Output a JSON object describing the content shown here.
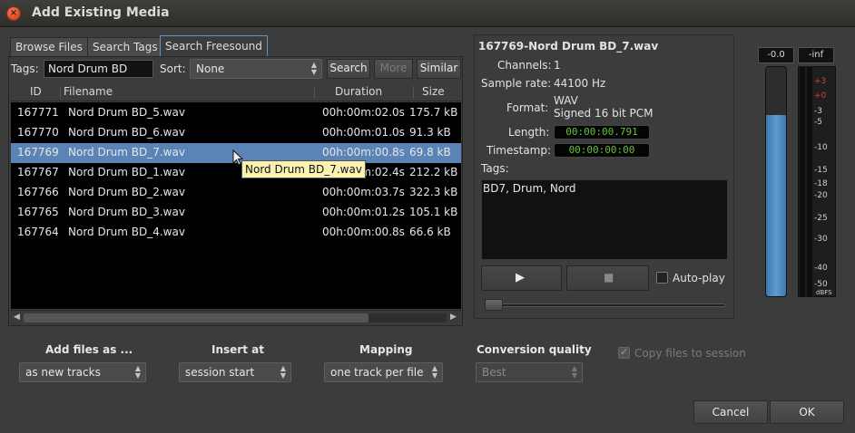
{
  "window": {
    "title": "Add Existing Media",
    "close_glyph": "×"
  },
  "tabs": [
    {
      "label": "Browse Files"
    },
    {
      "label": "Search Tags"
    },
    {
      "label": "Search Freesound"
    }
  ],
  "search": {
    "tags_label": "Tags:",
    "tags_value": "Nord Drum BD",
    "sort_label": "Sort:",
    "sort_value": "None",
    "search_button": "Search",
    "more_button": "More",
    "similar_button": "Similar"
  },
  "table": {
    "columns": [
      "ID",
      "Filename",
      "Duration",
      "Size"
    ],
    "rows": [
      {
        "id": "167771",
        "filename": "Nord Drum BD_5.wav",
        "duration": "00h:00m:02.0s",
        "size": "175.7 kB"
      },
      {
        "id": "167770",
        "filename": "Nord Drum BD_6.wav",
        "duration": "00h:00m:01.0s",
        "size": "91.3 kB"
      },
      {
        "id": "167769",
        "filename": "Nord Drum BD_7.wav",
        "duration": "00h:00m:00.8s",
        "size": "69.8 kB"
      },
      {
        "id": "167767",
        "filename": "Nord Drum BD_1.wav",
        "duration": "00h:00m:02.4s",
        "size": "212.2 kB"
      },
      {
        "id": "167766",
        "filename": "Nord Drum BD_2.wav",
        "duration": "00h:00m:03.7s",
        "size": "322.3 kB"
      },
      {
        "id": "167765",
        "filename": "Nord Drum BD_3.wav",
        "duration": "00h:00m:01.2s",
        "size": "105.1 kB"
      },
      {
        "id": "167764",
        "filename": "Nord Drum BD_4.wav",
        "duration": "00h:00m:00.8s",
        "size": "66.6 kB"
      }
    ],
    "selected_index": 2,
    "tooltip": "Nord Drum BD_7.wav"
  },
  "info": {
    "file_title": "167769-Nord Drum BD_7.wav",
    "channels_label": "Channels:",
    "channels_value": "1",
    "sample_rate_label": "Sample rate:",
    "sample_rate_value": "44100 Hz",
    "format_label": "Format:",
    "format_line1": "WAV",
    "format_line2": "Signed 16 bit PCM",
    "length_label": "Length:",
    "length_value": "00:00:00.791",
    "timestamp_label": "Timestamp:",
    "timestamp_value": "00:00:00:00",
    "tags_label": "Tags:",
    "tags_value": "BD7, Drum, Nord",
    "autoplay_label": "Auto-play",
    "play_glyph": "▶",
    "stop_glyph": "■"
  },
  "meters": {
    "left_readout": "-0.0",
    "right_readout": "-inf",
    "fill_fraction": 0.79,
    "red_ticks": [
      "+3",
      "+0"
    ],
    "white_ticks": [
      "-3",
      "-5",
      "-10",
      "-15",
      "-18",
      "-20",
      "-25",
      "-30",
      "-40",
      "-50"
    ],
    "unit": "dBFS",
    "colors": {
      "fill": "#4f8bc4",
      "red": "#d04040"
    }
  },
  "options": {
    "add_files_label": "Add files as ...",
    "add_files_value": "as new tracks",
    "insert_at_label": "Insert at",
    "insert_at_value": "session start",
    "mapping_label": "Mapping",
    "mapping_value": "one track per file",
    "conversion_label": "Conversion quality",
    "conversion_value": "Best",
    "copy_label": "Copy files to session"
  },
  "buttons": {
    "cancel": "Cancel",
    "ok": "OK"
  }
}
